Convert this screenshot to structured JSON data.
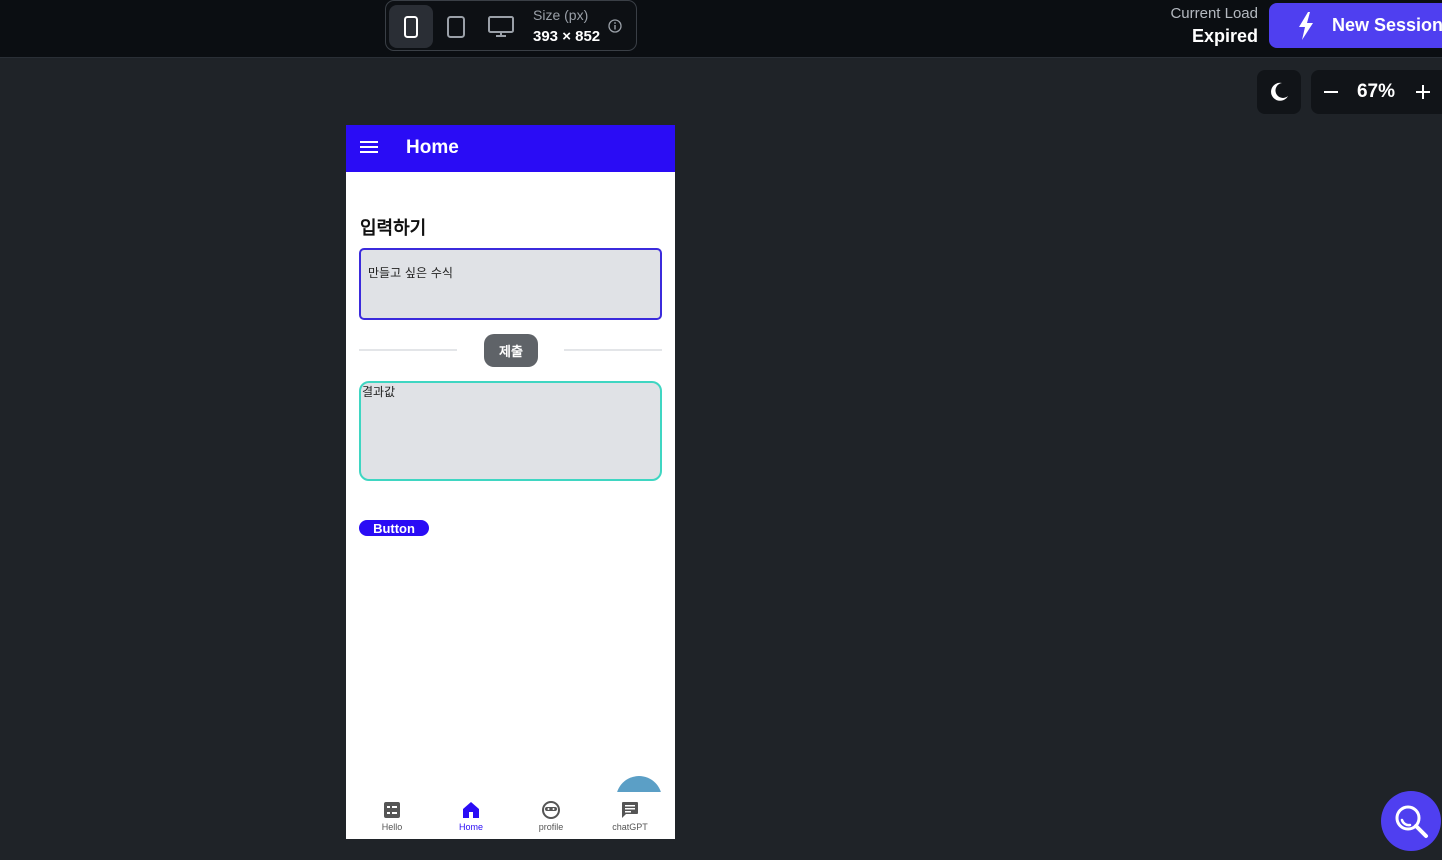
{
  "topbar": {
    "size_label": "Size (px)",
    "size_value": "393 × 852",
    "devices": [
      "phone-icon",
      "tablet-icon",
      "desktop-icon"
    ],
    "active_device": "phone-icon",
    "current_load_label": "Current Load",
    "current_load_value": "Expired",
    "new_session_label": "New Session"
  },
  "controls": {
    "theme_icon": "moon-icon",
    "zoom": "67%"
  },
  "app": {
    "title": "Home",
    "section_title": "입력하기",
    "input_placeholder": "만들고 싶은 수식",
    "submit_label": "제출",
    "result_placeholder": "결과값",
    "button_label": "Button",
    "nav": [
      {
        "label": "Hello",
        "icon": "list-icon"
      },
      {
        "label": "Home",
        "icon": "home-icon"
      },
      {
        "label": "profile",
        "icon": "face-icon"
      },
      {
        "label": "chatGPT",
        "icon": "chat-icon"
      }
    ],
    "active_nav": "Home"
  },
  "colors": {
    "accent": "#4f3ff0",
    "appbar": "#2a0cf5",
    "result_border": "#3fd6c2"
  }
}
